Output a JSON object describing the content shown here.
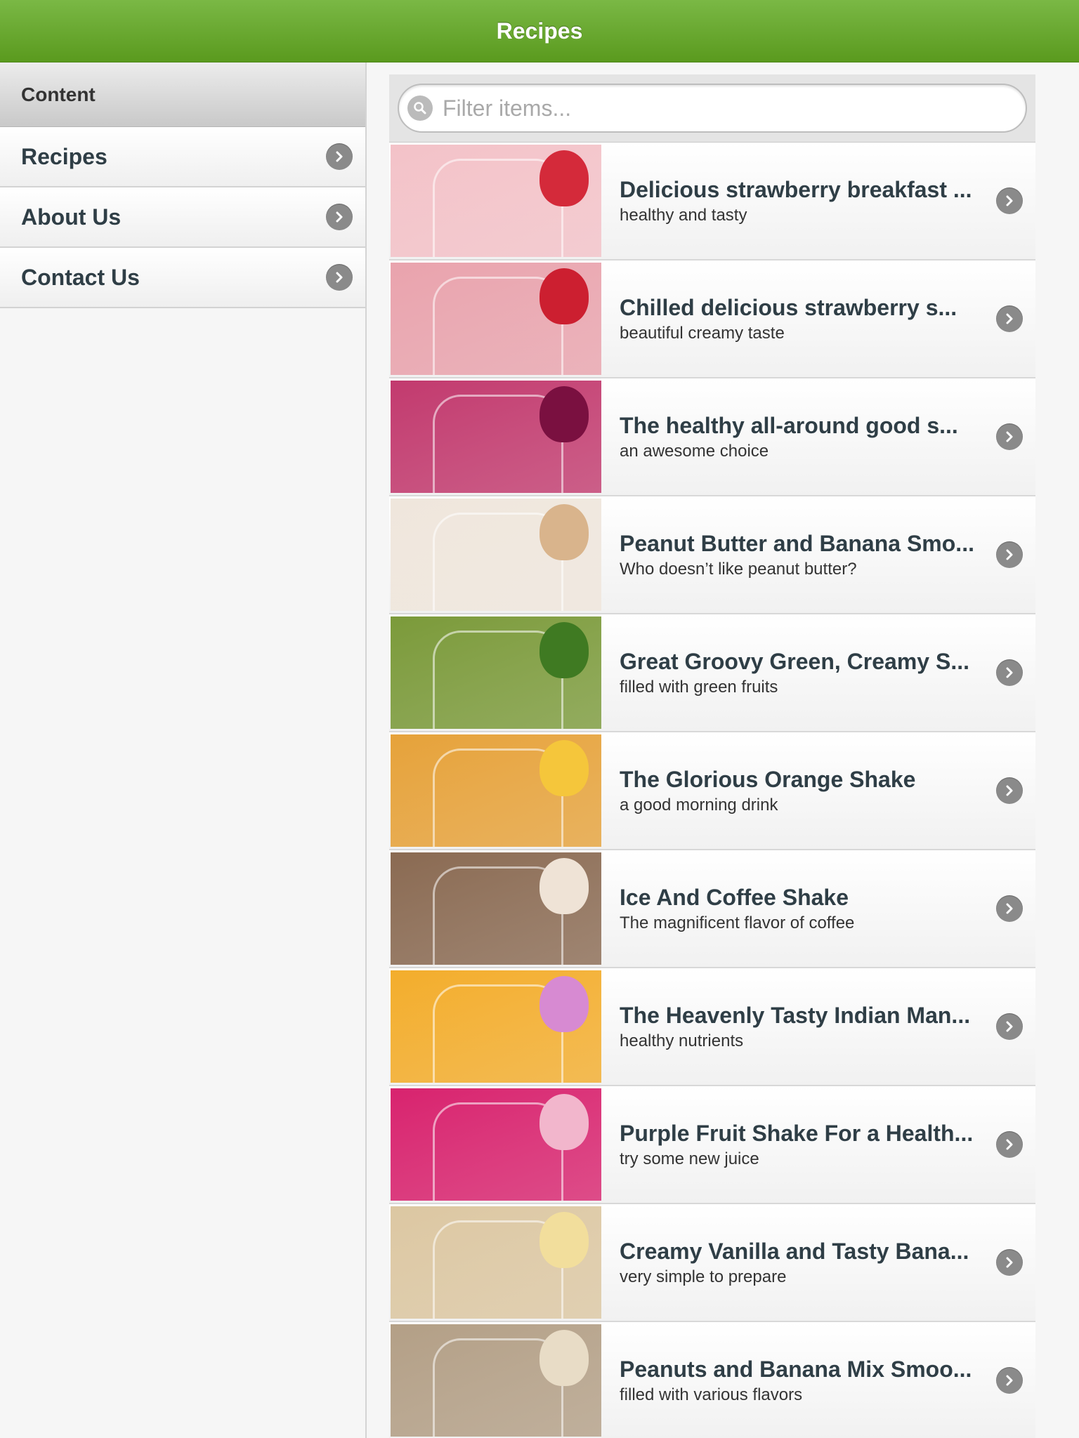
{
  "header": {
    "title": "Recipes"
  },
  "sidebar": {
    "heading": "Content",
    "items": [
      {
        "label": "Recipes"
      },
      {
        "label": "About Us"
      },
      {
        "label": "Contact Us"
      }
    ]
  },
  "filter": {
    "placeholder": "Filter items..."
  },
  "recipes": [
    {
      "title": "Delicious strawberry breakfast ...",
      "subtitle": "healthy and tasty",
      "bg": "#f3c2c8",
      "fruit": "#d42a3a"
    },
    {
      "title": "Chilled delicious strawberry s...",
      "subtitle": "beautiful creamy taste",
      "bg": "#e9a3ad",
      "fruit": "#cc1f30"
    },
    {
      "title": "The healthy all-around good s...",
      "subtitle": "an awesome choice",
      "bg": "#c23a6e",
      "fruit": "#7a1040"
    },
    {
      "title": "Peanut Butter and Banana Smo...",
      "subtitle": "Who doesn’t like peanut butter?",
      "bg": "#efe6dc",
      "fruit": "#d9b48c"
    },
    {
      "title": "Great Groovy Green, Creamy S...",
      "subtitle": "filled with green fruits",
      "bg": "#7b9a3a",
      "fruit": "#3f7a22"
    },
    {
      "title": "The Glorious Orange Shake",
      "subtitle": "a good morning drink",
      "bg": "#e6a23a",
      "fruit": "#f5c63b"
    },
    {
      "title": "Ice And Coffee Shake",
      "subtitle": "The magnificent flavor of coffee",
      "bg": "#8a6a52",
      "fruit": "#efe3d6"
    },
    {
      "title": "The Heavenly Tasty Indian Man...",
      "subtitle": "healthy nutrients",
      "bg": "#f3ad2c",
      "fruit": "#d78ad2"
    },
    {
      "title": "Purple Fruit Shake For a Health...",
      "subtitle": "try some new juice",
      "bg": "#d8236e",
      "fruit": "#f2b6cc"
    },
    {
      "title": "Creamy Vanilla and Tasty Bana...",
      "subtitle": "very simple to prepare",
      "bg": "#dcc7a2",
      "fruit": "#f2de9c"
    },
    {
      "title": "Peanuts and Banana Mix Smoo...",
      "subtitle": "filled with various flavors",
      "bg": "#b39f86",
      "fruit": "#e8dcc6"
    }
  ]
}
